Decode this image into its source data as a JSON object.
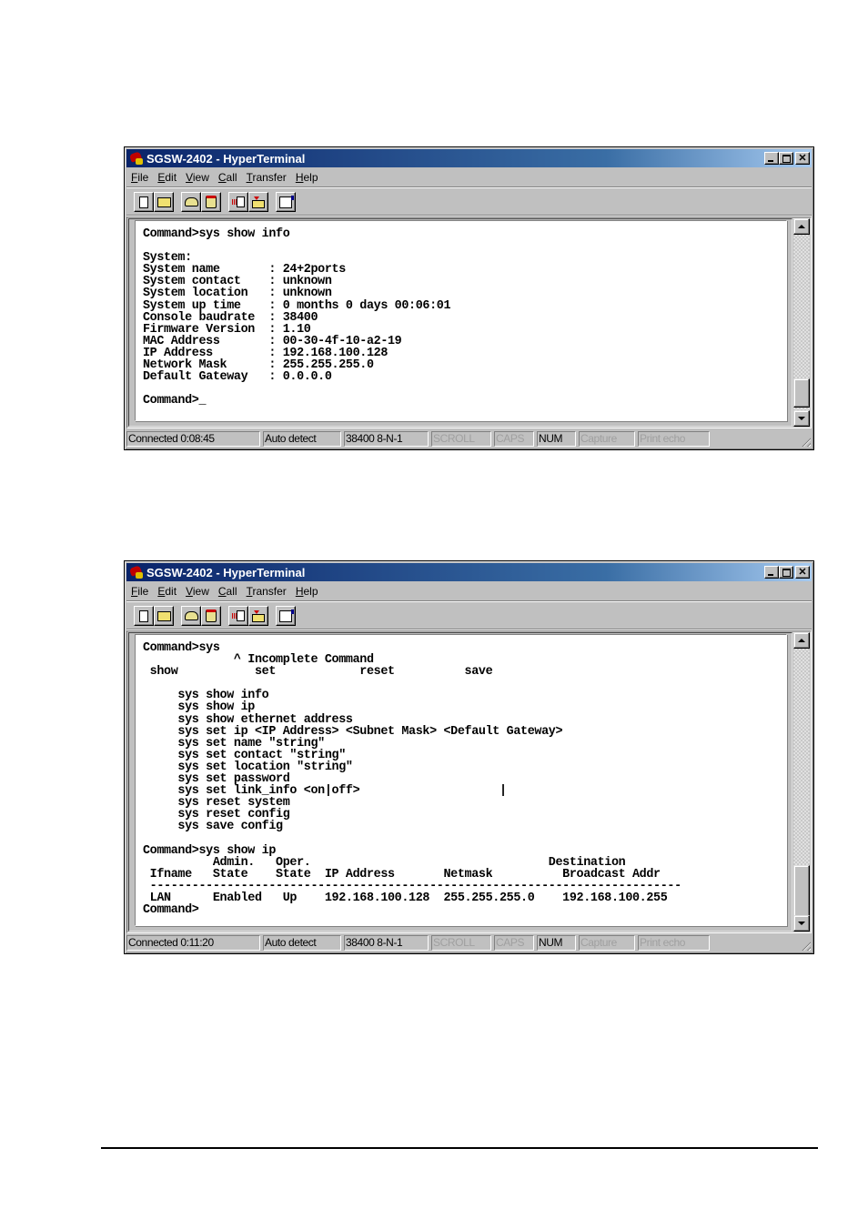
{
  "windows": [
    {
      "title": "SGSW-2402 - HyperTerminal",
      "menu": [
        {
          "key": "F",
          "rest": "ile"
        },
        {
          "key": "E",
          "rest": "dit"
        },
        {
          "key": "V",
          "rest": "iew"
        },
        {
          "key": "C",
          "rest": "all"
        },
        {
          "key": "T",
          "rest": "ransfer"
        },
        {
          "key": "H",
          "rest": "elp"
        }
      ],
      "toolbar": [
        "new-icon",
        "open-icon",
        "dial-icon",
        "disconnect-icon",
        "send-icon",
        "receive-icon",
        "properties-icon"
      ],
      "terminal_lines": [
        "Command>sys show info",
        "",
        "System:",
        "System name       : 24+2ports",
        "System contact    : unknown",
        "System location   : unknown",
        "System up time    : 0 months 0 days 00:06:01",
        "Console baudrate  : 38400",
        "Firmware Version  : 1.10",
        "MAC Address       : 00-30-4f-10-a2-19",
        "IP Address        : 192.168.100.128",
        "Network Mask      : 255.255.255.0",
        "Default Gateway   : 0.0.0.0",
        "",
        "Command>_"
      ],
      "status": {
        "connected": "Connected 0:08:45",
        "detect": "Auto detect",
        "port": "38400 8-N-1",
        "scroll": "SCROLL",
        "caps": "CAPS",
        "num": "NUM",
        "capture": "Capture",
        "print_echo": "Print echo"
      }
    },
    {
      "title": "SGSW-2402 - HyperTerminal",
      "menu": [
        {
          "key": "F",
          "rest": "ile"
        },
        {
          "key": "E",
          "rest": "dit"
        },
        {
          "key": "V",
          "rest": "iew"
        },
        {
          "key": "C",
          "rest": "all"
        },
        {
          "key": "T",
          "rest": "ransfer"
        },
        {
          "key": "H",
          "rest": "elp"
        }
      ],
      "toolbar": [
        "new-icon",
        "open-icon",
        "dial-icon",
        "disconnect-icon",
        "send-icon",
        "receive-icon",
        "properties-icon"
      ],
      "terminal_lines": [
        "Command>sys",
        "             ^ Incomplete Command",
        " show           set            reset          save",
        "",
        "     sys show info",
        "     sys show ip",
        "     sys show ethernet address",
        "     sys set ip <IP Address> <Subnet Mask> <Default Gateway>",
        "     sys set name \"string\"",
        "     sys set contact \"string\"",
        "     sys set location \"string\"",
        "     sys set password",
        "     sys set link_info <on|off>                    |",
        "     sys reset system",
        "     sys reset config",
        "     sys save config",
        "",
        "Command>sys show ip",
        "          Admin.   Oper.                                  Destination",
        " Ifname   State    State  IP Address       Netmask          Broadcast Addr",
        " ----------------------------------------------------------------------------",
        " LAN      Enabled   Up    192.168.100.128  255.255.255.0    192.168.100.255",
        "Command>"
      ],
      "status": {
        "connected": "Connected 0:11:20",
        "detect": "Auto detect",
        "port": "38400 8-N-1",
        "scroll": "SCROLL",
        "caps": "CAPS",
        "num": "NUM",
        "capture": "Capture",
        "print_echo": "Print echo"
      }
    }
  ]
}
